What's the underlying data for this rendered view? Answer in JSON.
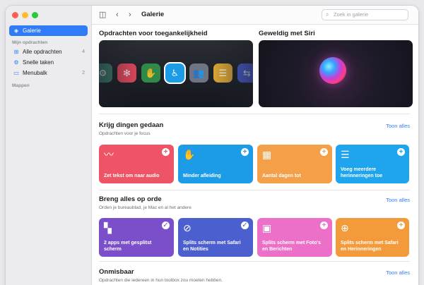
{
  "window": {
    "title": "Galerie",
    "search_placeholder": "Zoek in galerie"
  },
  "sidebar": {
    "gallery": {
      "label": "Galerie",
      "icon": "layers-icon"
    },
    "section_my": "Mijn opdrachten",
    "items": [
      {
        "label": "Alle opdrachten",
        "count": "4",
        "icon": "grid-icon"
      },
      {
        "label": "Snelle taken",
        "count": "",
        "icon": "gear-icon"
      },
      {
        "label": "Menubalk",
        "count": "2",
        "icon": "menubar-icon"
      }
    ],
    "section_folders": "Mappen"
  },
  "heroes": [
    {
      "title": "Opdrachten voor toegankelijkheid"
    },
    {
      "title": "Geweldig met Siri"
    }
  ],
  "hero_icons": [
    {
      "icon": "gear-icon",
      "glyph": "⚙",
      "color": "#3a7d6c"
    },
    {
      "icon": "asterisk-icon",
      "glyph": "✻",
      "color": "#d9465a"
    },
    {
      "icon": "hand-icon",
      "glyph": "✋",
      "color": "#2f8a4a"
    },
    {
      "icon": "accessibility-icon",
      "glyph": "♿",
      "color": "#1c9be6"
    },
    {
      "icon": "people-icon",
      "glyph": "👥",
      "color": "#6f7382"
    },
    {
      "icon": "sliders-icon",
      "glyph": "☰",
      "color": "#d6a236"
    },
    {
      "icon": "toggle-icon",
      "glyph": "⇆",
      "color": "#4a5fd9"
    }
  ],
  "sections": [
    {
      "title": "Krijg dingen gedaan",
      "subtitle": "Opdrachten voor je focus",
      "see_all": "Toon alles",
      "cards": [
        {
          "label": "Zet tekst om naar audio",
          "icon": "waveform-icon",
          "glyph": "〰",
          "color": "#ee5466",
          "badge": "+"
        },
        {
          "label": "Minder afleiding",
          "icon": "hand-icon",
          "glyph": "✋",
          "color": "#1c9be6",
          "badge": "+"
        },
        {
          "label": "Aantal dagen tot",
          "icon": "calendar-icon",
          "glyph": "▦",
          "color": "#f3a048",
          "badge": "+"
        },
        {
          "label": "Voeg meerdere herinneringen toe",
          "icon": "list-icon",
          "glyph": "☰",
          "color": "#1fa5ee",
          "badge": "+"
        }
      ]
    },
    {
      "title": "Breng alles op orde",
      "subtitle": "Orden je bureaublad, je Mac en al het andere",
      "see_all": "Toon alles",
      "cards": [
        {
          "label": "2 apps met gesplitst scherm",
          "icon": "split-grid-icon",
          "glyph": "▚",
          "color": "#7b4fc9",
          "badge": "✓"
        },
        {
          "label": "Splits scherm met Safari en Notities",
          "icon": "compass-icon",
          "glyph": "⊘",
          "color": "#4c5fcf",
          "badge": "✓"
        },
        {
          "label": "Splits scherm met Foto's en Berichten",
          "icon": "photo-icon",
          "glyph": "▣",
          "color": "#ec6fc8",
          "badge": "+"
        },
        {
          "label": "Splits scherm met Safari en Herinneringen",
          "icon": "globe-icon",
          "glyph": "⊕",
          "color": "#f39a3a",
          "badge": "+"
        }
      ]
    },
    {
      "title": "Onmisbaar",
      "subtitle": "Opdrachten die iedereen in hun toolbox zou moeten hebben.",
      "see_all": "Toon alles",
      "cards": []
    }
  ]
}
